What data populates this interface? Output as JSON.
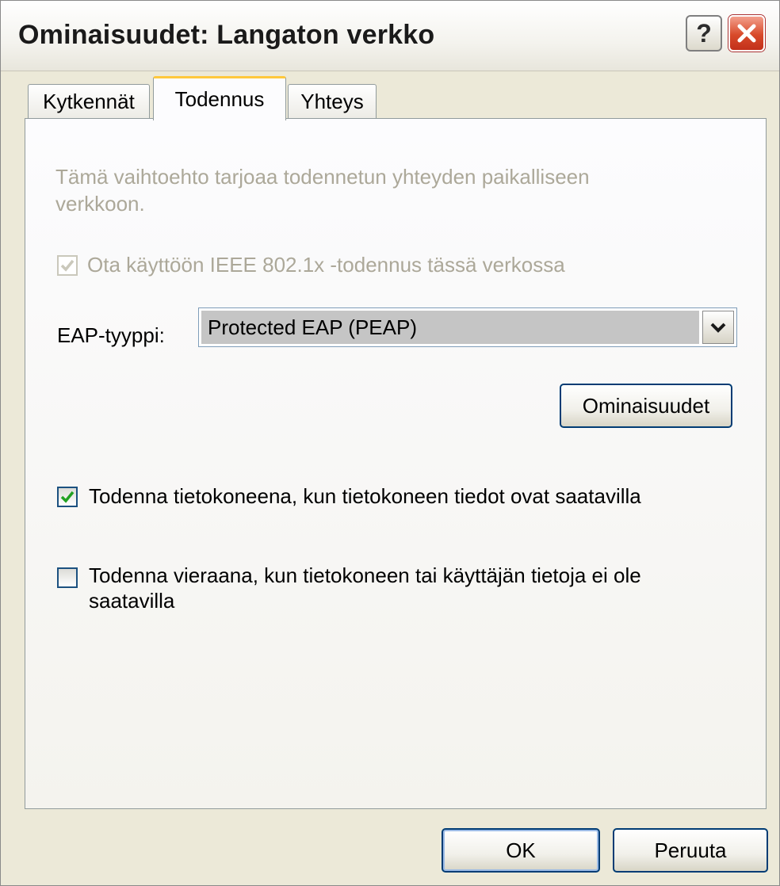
{
  "window": {
    "title": "Ominaisuudet: Langaton verkko",
    "help_icon": "question-mark-icon",
    "close_icon": "close-icon"
  },
  "tabs": [
    {
      "label": "Kytkennät",
      "selected": false
    },
    {
      "label": "Todennus",
      "selected": true
    },
    {
      "label": "Yhteys",
      "selected": false
    }
  ],
  "auth": {
    "description": "Tämä vaihtoehto tarjoaa todennetun yhteyden paikalliseen verkkoon.",
    "ieee_checkbox_label": "Ota käyttöön IEEE 802.1x -todennus tässä verkossa",
    "ieee_checked": true,
    "eap_label": "EAP-tyyppi:",
    "eap_value": "Protected EAP (PEAP)",
    "properties_button": "Ominaisuudet",
    "computer_auth_label": "Todenna tietokoneena, kun tietokoneen tiedot ovat saatavilla",
    "computer_auth_checked": true,
    "guest_auth_label": "Todenna vieraana, kun tietokoneen tai käyttäjän tietoja ei ole saatavilla",
    "guest_auth_checked": false
  },
  "footer": {
    "ok_label": "OK",
    "cancel_label": "Peruuta"
  },
  "colors": {
    "window_bg": "#ece9d8",
    "tab_highlight": "#ffc83c",
    "disabled_text": "#aca899",
    "check_green": "#21a121",
    "close_red": "#d84a2a"
  }
}
